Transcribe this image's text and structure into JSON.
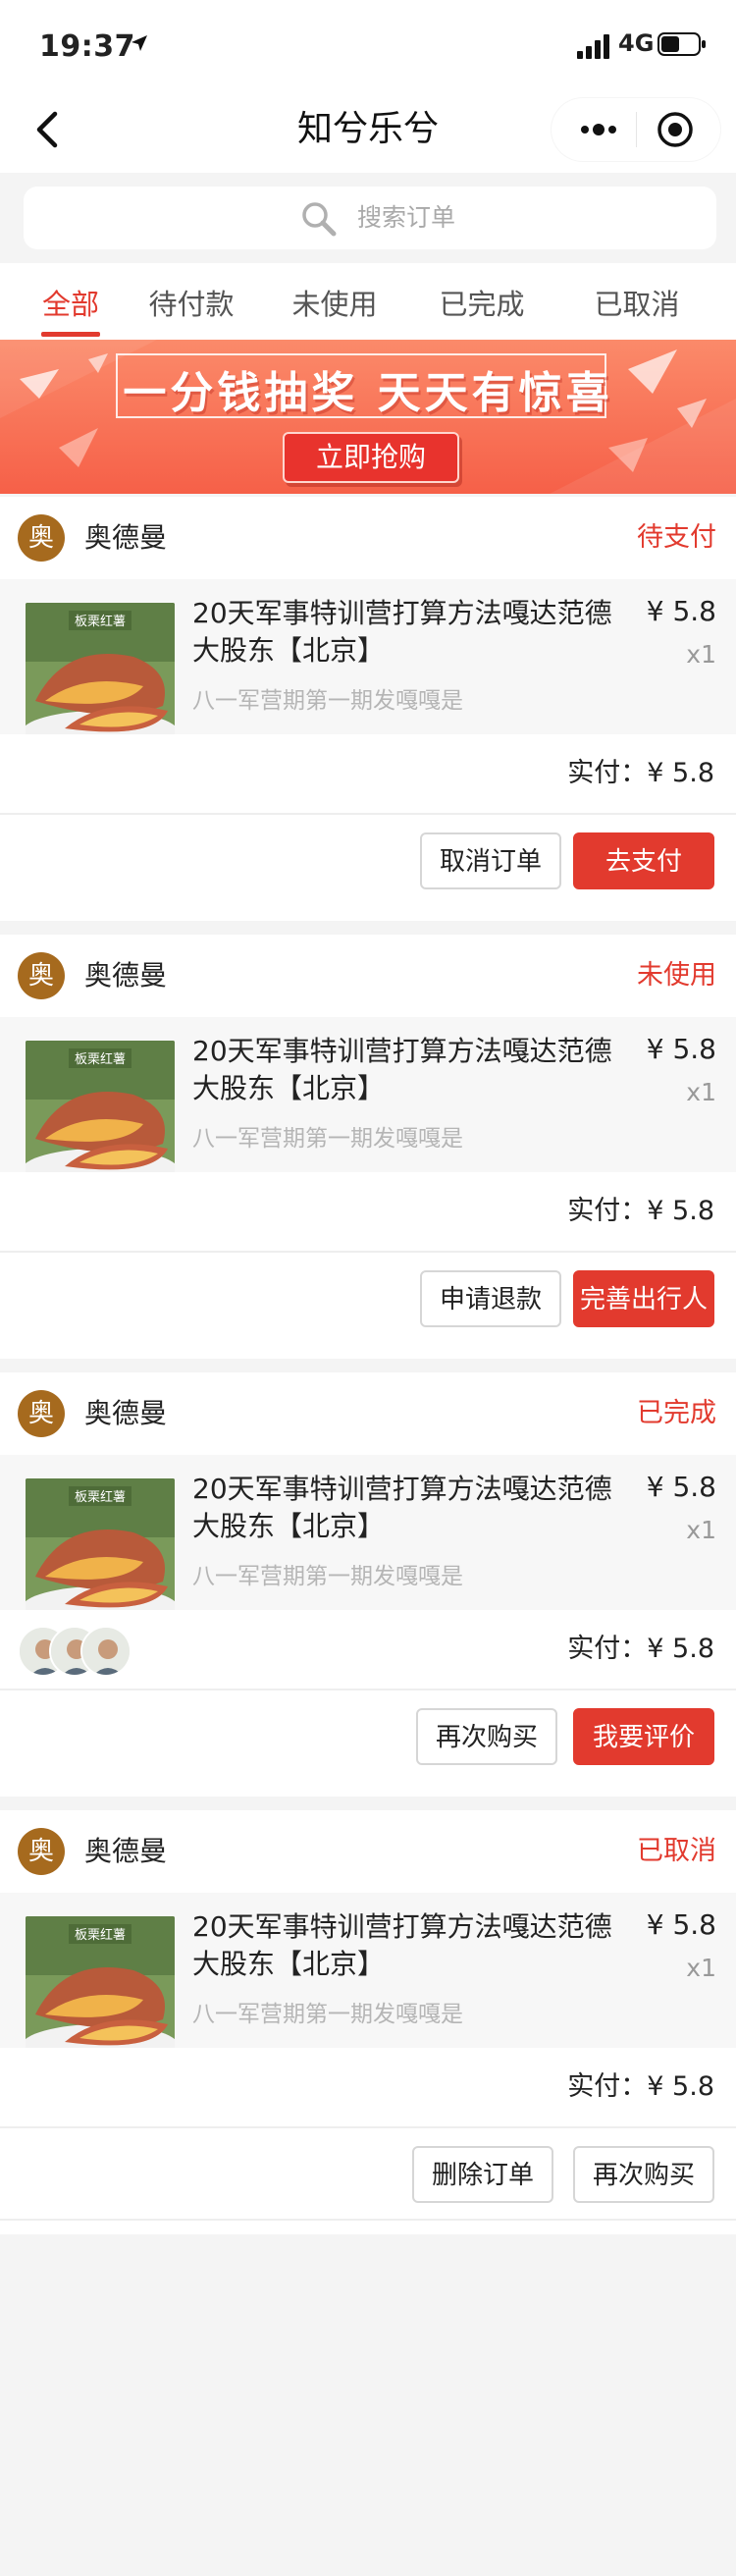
{
  "status_bar": {
    "time": "19:37",
    "network": "4G",
    "icons": [
      "location-arrow-icon",
      "signal-icon",
      "battery-icon"
    ]
  },
  "nav": {
    "title": "知兮乐兮",
    "icons": [
      "back-icon",
      "more-icon",
      "close-capsule-icon"
    ]
  },
  "search": {
    "placeholder": "搜索订单",
    "icon": "search-icon"
  },
  "tabs": [
    {
      "label": "全部",
      "active": true
    },
    {
      "label": "待付款",
      "active": false
    },
    {
      "label": "未使用",
      "active": false
    },
    {
      "label": "已完成",
      "active": false
    },
    {
      "label": "已取消",
      "active": false
    }
  ],
  "banner": {
    "headline": "一分钱抽奖 天天有惊喜",
    "button": "立即抢购"
  },
  "colors": {
    "accent": "#e23a2e",
    "shop_avatar": "#a66a1e",
    "background": "#f4f4f4"
  },
  "orders": [
    {
      "shop_avatar": "奥",
      "shop_name": "奥德曼",
      "status": "待支付",
      "item": {
        "title": "20天军事特训营打算方法嘎达范德大股东【北京】",
        "subtitle": "八一军营期第一期发嘎嘎是",
        "price": "¥ 5.8",
        "qty": "x1",
        "image_label": "板栗红薯"
      },
      "paid_label": "实付：",
      "paid_amount": "¥ 5.8",
      "buttons": [
        "取消订单",
        "去支付"
      ]
    },
    {
      "shop_avatar": "奥",
      "shop_name": "奥德曼",
      "status": "未使用",
      "item": {
        "title": "20天军事特训营打算方法嘎达范德大股东【北京】",
        "subtitle": "八一军营期第一期发嘎嘎是",
        "price": "¥ 5.8",
        "qty": "x1",
        "image_label": "板栗红薯"
      },
      "paid_label": "实付：",
      "paid_amount": "¥ 5.8",
      "buttons": [
        "申请退款",
        "完善出行人"
      ]
    },
    {
      "shop_avatar": "奥",
      "shop_name": "奥德曼",
      "status": "已完成",
      "item": {
        "title": "20天军事特训营打算方法嘎达范德大股东【北京】",
        "subtitle": "八一军营期第一期发嘎嘎是",
        "price": "¥ 5.8",
        "qty": "x1",
        "image_label": "板栗红薯"
      },
      "paid_label": "实付：",
      "paid_amount": "¥ 5.8",
      "participants": 3,
      "buttons": [
        "再次购买",
        "我要评价"
      ]
    },
    {
      "shop_avatar": "奥",
      "shop_name": "奥德曼",
      "status": "已取消",
      "item": {
        "title": "20天军事特训营打算方法嘎达范德大股东【北京】",
        "subtitle": "八一军营期第一期发嘎嘎是",
        "price": "¥ 5.8",
        "qty": "x1",
        "image_label": "板栗红薯"
      },
      "paid_label": "实付：",
      "paid_amount": "¥ 5.8",
      "buttons": [
        "删除订单",
        "再次购买"
      ]
    }
  ]
}
